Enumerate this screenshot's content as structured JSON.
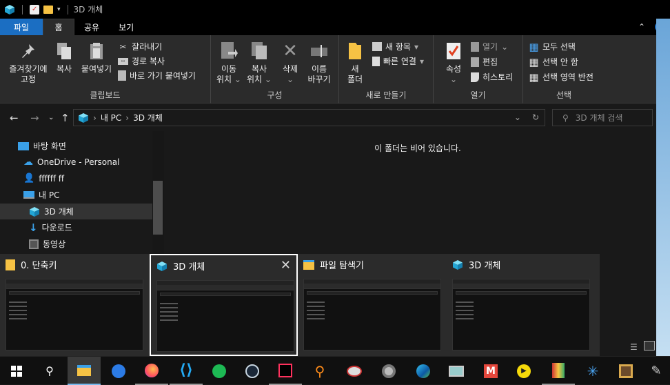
{
  "window": {
    "title": "3D 개체"
  },
  "ribbon_tabs": [
    {
      "label": "파일"
    },
    {
      "label": "홈"
    },
    {
      "label": "공유"
    },
    {
      "label": "보기"
    }
  ],
  "clipboard": {
    "pin": "즐겨찾기에\n고정",
    "copy": "복사",
    "paste": "붙여넣기",
    "cut": "잘라내기",
    "copy_path": "경로 복사",
    "paste_shortcut": "바로 가기 붙여넣기",
    "label": "클립보드"
  },
  "organize": {
    "move": "이동\n위치",
    "copy": "복사\n위치",
    "delete": "삭제",
    "rename": "이름\n바꾸기",
    "label": "구성"
  },
  "new": {
    "new_folder": "새\n폴더",
    "new_item": "새 항목",
    "easy_access": "빠른 연결",
    "label": "새로 만들기"
  },
  "open": {
    "properties": "속성",
    "open": "열기",
    "edit": "편집",
    "history": "히스토리",
    "label": "열기"
  },
  "select": {
    "select_all": "모두 선택",
    "select_none": "선택 안 함",
    "invert": "선택 영역 반전",
    "label": "선택"
  },
  "address": {
    "root": "내 PC",
    "current": "3D 개체"
  },
  "search": {
    "placeholder": "3D 개체 검색"
  },
  "nav": [
    {
      "label": "바탕 화면"
    },
    {
      "label": "OneDrive - Personal"
    },
    {
      "label": "ffffff ff"
    },
    {
      "label": "내 PC"
    },
    {
      "label": "3D 개체"
    },
    {
      "label": "다운로드"
    },
    {
      "label": "동영상"
    }
  ],
  "main": {
    "empty_text": "이 폴더는 비어 있습니다."
  },
  "task_cards": [
    {
      "title": "0. 단축키"
    },
    {
      "title": "3D 개체"
    },
    {
      "title": "파일 탐색기"
    },
    {
      "title": "3D 개체"
    }
  ],
  "colors": {
    "accent": "#1b6ec2",
    "taskbar": "#101010"
  }
}
